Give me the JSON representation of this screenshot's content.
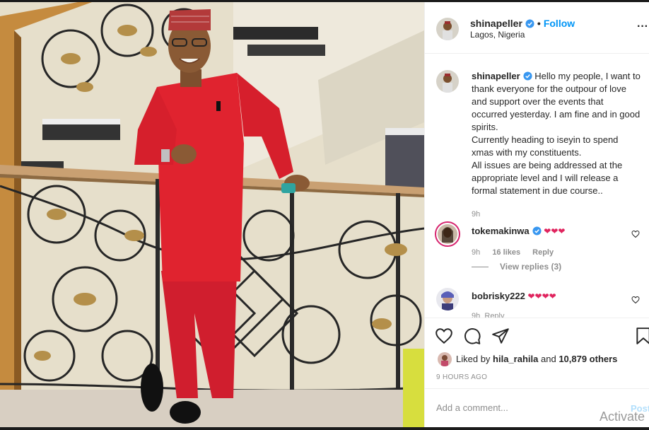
{
  "post": {
    "username": "shinapeller",
    "follow_label": "Follow",
    "separator": "•",
    "location": "Lagos, Nigeria",
    "more_label": "···"
  },
  "caption": {
    "username": "shinapeller",
    "text_lines": [
      "Hello my people, I want to thank everyone for the outpour of love and support over the events that occurred yesterday. I am fine and in good spirits.",
      "Currently heading to iseyin to spend xmas with my constituents.",
      "All issues are being addressed at the appropriate level and I will release a formal statement in due course.."
    ],
    "time": "9h"
  },
  "comments": [
    {
      "username": "tokemakinwa",
      "text": "❤❤❤",
      "time": "9h",
      "likes": "16 likes",
      "reply_label": "Reply",
      "view_replies": "View replies (3)"
    },
    {
      "username": "bobrisky222",
      "text": "❤❤❤❤",
      "time": "9h",
      "reply_label": "Reply"
    }
  ],
  "likes": {
    "prefix": "Liked by",
    "user": "hila_rahila",
    "conjunction": "and",
    "others": "10,879 others"
  },
  "timestamp": "9 HOURS AGO",
  "add_comment": {
    "placeholder": "Add a comment...",
    "post_label": "Post"
  },
  "watermark": "Activate",
  "icons": {
    "verified": "verified-badge-icon",
    "like": "heart-icon",
    "comment": "comment-icon",
    "share": "share-icon",
    "save": "bookmark-icon"
  },
  "colors": {
    "accent": "#0095f6",
    "verified": "#3897f0",
    "heart_red": "#e0245e",
    "muted": "#8e8e8e"
  }
}
